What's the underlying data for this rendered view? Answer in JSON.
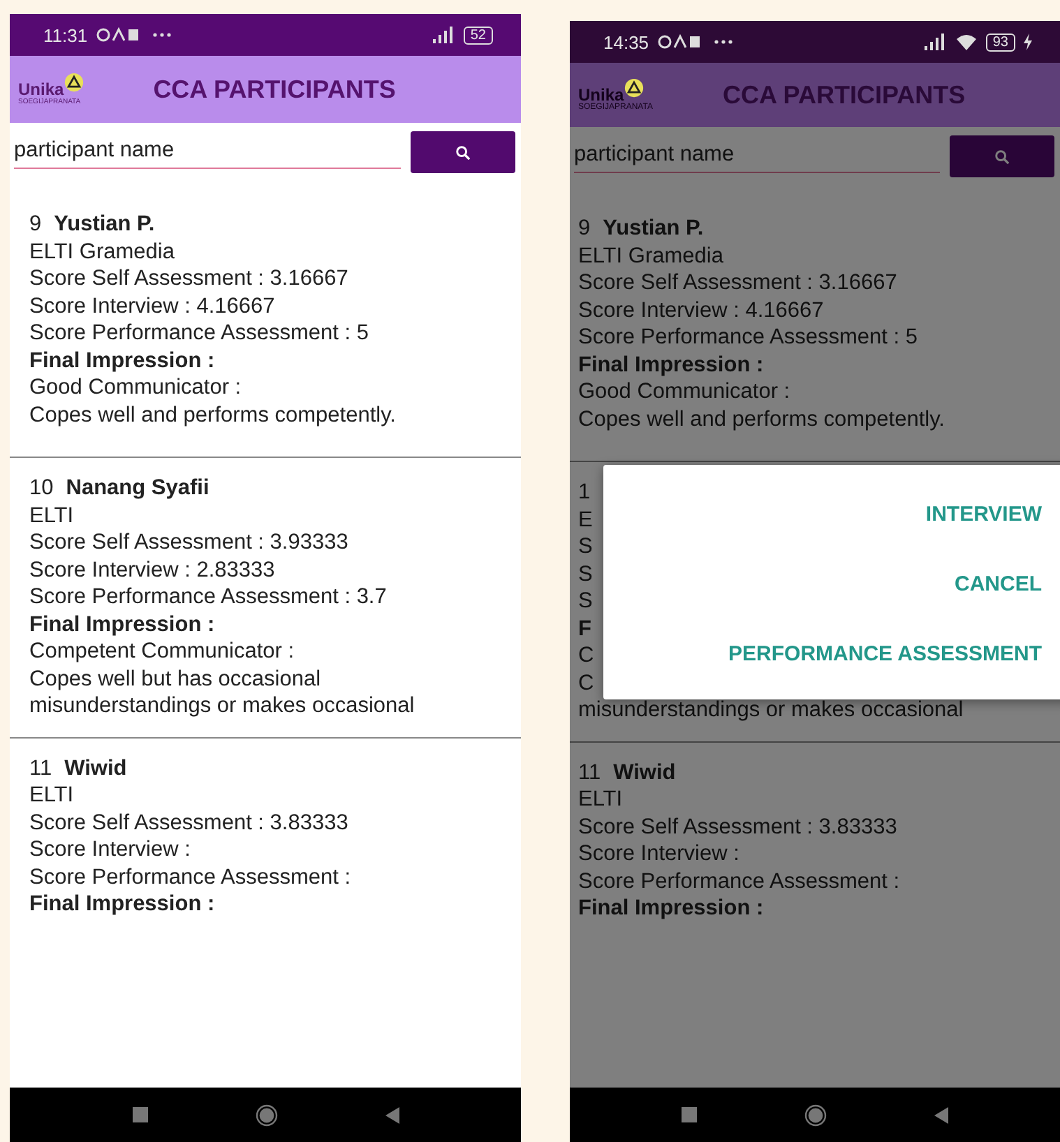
{
  "screens": [
    {
      "status_bar": {
        "time": "11:31",
        "battery": "52",
        "charging": false,
        "wifi": false
      },
      "header": {
        "logo_text": "Unika",
        "logo_subtext": "SOEGIJAPRANATA",
        "title": "CCA PARTICIPANTS"
      },
      "search": {
        "placeholder": "participant name"
      },
      "participants": [
        {
          "lines": [
            {
              "kind": "title",
              "number": "9",
              "name": "Yustian P."
            },
            {
              "kind": "text",
              "text": "ELTI Gramedia"
            },
            {
              "kind": "text",
              "text": "Score Self Assessment :  3.16667"
            },
            {
              "kind": "text",
              "text": "Score Interview :  4.16667"
            },
            {
              "kind": "text",
              "text": "Score Performance Assessment :  5"
            },
            {
              "kind": "bold",
              "text": "Final Impression :"
            },
            {
              "kind": "text",
              "text": "Good Communicator :"
            },
            {
              "kind": "text",
              "text": "Copes well and performs competently."
            }
          ]
        },
        {
          "lines": [
            {
              "kind": "title",
              "number": "10",
              "name": "Nanang Syafii"
            },
            {
              "kind": "text",
              "text": "ELTI"
            },
            {
              "kind": "text",
              "text": "Score Self Assessment :  3.93333"
            },
            {
              "kind": "text",
              "text": "Score Interview :  2.83333"
            },
            {
              "kind": "text",
              "text": "Score Performance Assessment :  3.7"
            },
            {
              "kind": "bold",
              "text": "Final Impression :"
            },
            {
              "kind": "text",
              "text": "Competent Communicator :"
            },
            {
              "kind": "text",
              "text": "Copes well but has occasional"
            },
            {
              "kind": "text",
              "text": "misunderstandings or makes occasional"
            }
          ]
        },
        {
          "lines": [
            {
              "kind": "title",
              "number": "11",
              "name": "Wiwid"
            },
            {
              "kind": "text",
              "text": "ELTI"
            },
            {
              "kind": "text",
              "text": "Score Self Assessment :  3.83333"
            },
            {
              "kind": "text",
              "text": "Score Interview :"
            },
            {
              "kind": "text",
              "text": "Score Performance Assessment :"
            },
            {
              "kind": "bold",
              "text": "Final Impression :"
            }
          ]
        }
      ]
    },
    {
      "status_bar": {
        "time": "14:35",
        "battery": "93",
        "charging": true,
        "wifi": true
      },
      "header": {
        "logo_text": "Unika",
        "logo_subtext": "SOEGIJAPRANATA",
        "title": "CCA PARTICIPANTS"
      },
      "search": {
        "placeholder": "participant name"
      },
      "participants": [
        {
          "lines": [
            {
              "kind": "title",
              "number": "9",
              "name": "Yustian P."
            },
            {
              "kind": "text",
              "text": "ELTI Gramedia"
            },
            {
              "kind": "text",
              "text": "Score Self Assessment :  3.16667"
            },
            {
              "kind": "text",
              "text": "Score Interview :  4.16667"
            },
            {
              "kind": "text",
              "text": "Score Performance Assessment :  5"
            },
            {
              "kind": "bold",
              "text": "Final Impression :"
            },
            {
              "kind": "text",
              "text": "Good Communicator :"
            },
            {
              "kind": "text",
              "text": "Copes well and performs competently."
            }
          ]
        },
        {
          "lines": [
            {
              "kind": "title",
              "number": "1"
            },
            {
              "kind": "text",
              "text": "E"
            },
            {
              "kind": "text",
              "text": "S"
            },
            {
              "kind": "text",
              "text": "S"
            },
            {
              "kind": "text",
              "text": "S"
            },
            {
              "kind": "bold",
              "text": "F"
            },
            {
              "kind": "text",
              "text": "C"
            },
            {
              "kind": "text",
              "text": "C"
            },
            {
              "kind": "text",
              "text": "misunderstandings or makes occasional"
            }
          ]
        },
        {
          "lines": [
            {
              "kind": "title",
              "number": "11",
              "name": "Wiwid"
            },
            {
              "kind": "text",
              "text": "ELTI"
            },
            {
              "kind": "text",
              "text": "Score Self Assessment :  3.83333"
            },
            {
              "kind": "text",
              "text": "Score Interview :"
            },
            {
              "kind": "text",
              "text": "Score Performance Assessment :"
            },
            {
              "kind": "bold",
              "text": "Final Impression :"
            }
          ]
        }
      ],
      "dialog": {
        "options": [
          "INTERVIEW",
          "CANCEL",
          "PERFORMANCE ASSESSMENT"
        ]
      }
    }
  ]
}
